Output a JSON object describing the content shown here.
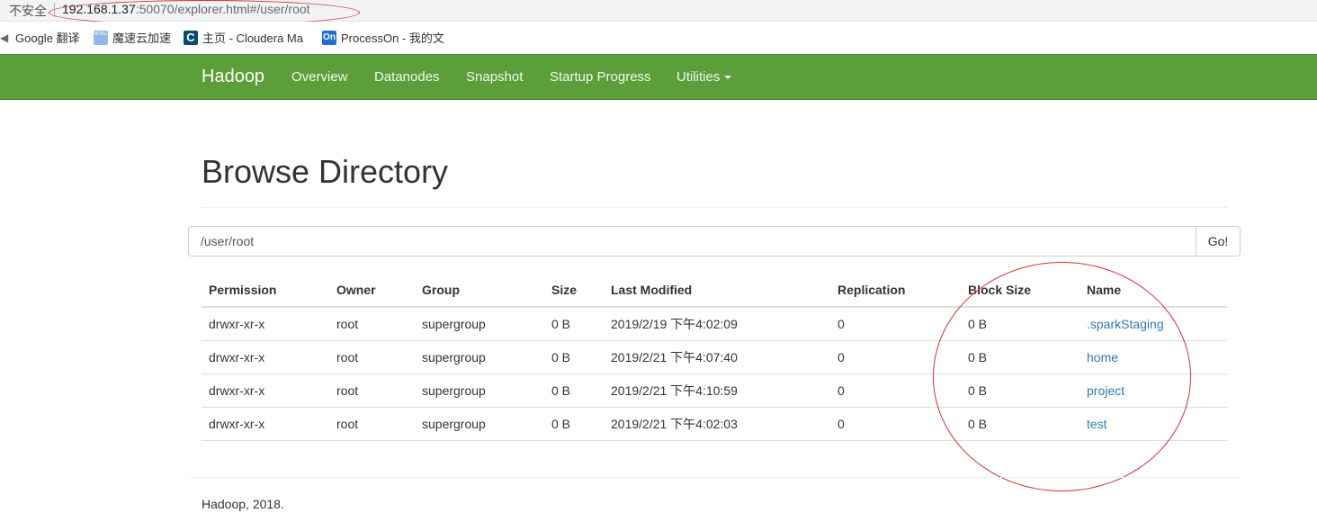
{
  "address_bar": {
    "security_label": "不安全",
    "url_host": "192.168.1.37",
    "url_rest": ":50070/explorer.html#/user/root"
  },
  "bookmarks": [
    {
      "label": "Google 翻译",
      "icon": "google-translate-icon"
    },
    {
      "label": "魔速云加速",
      "icon": "mosu-icon",
      "icon_text": "MOSU 魔速"
    },
    {
      "label": "主页 - Cloudera Ma",
      "icon": "cloudera-icon",
      "icon_text": "C"
    },
    {
      "label": "ProcessOn - 我的文",
      "icon": "processon-icon",
      "icon_text": "On"
    }
  ],
  "navbar": {
    "brand": "Hadoop",
    "links": [
      "Overview",
      "Datanodes",
      "Snapshot",
      "Startup Progress",
      "Utilities"
    ],
    "color": "#5c9e3a"
  },
  "page": {
    "title": "Browse Directory",
    "path_value": "/user/root",
    "go_label": "Go!"
  },
  "table": {
    "headers": [
      "Permission",
      "Owner",
      "Group",
      "Size",
      "Last Modified",
      "Replication",
      "Block Size",
      "Name"
    ],
    "rows": [
      [
        "drwxr-xr-x",
        "root",
        "supergroup",
        "0 B",
        "2019/2/19 下午4:02:09",
        "0",
        "0 B",
        ".sparkStaging"
      ],
      [
        "drwxr-xr-x",
        "root",
        "supergroup",
        "0 B",
        "2019/2/21 下午4:07:40",
        "0",
        "0 B",
        "home"
      ],
      [
        "drwxr-xr-x",
        "root",
        "supergroup",
        "0 B",
        "2019/2/21 下午4:10:59",
        "0",
        "0 B",
        "project"
      ],
      [
        "drwxr-xr-x",
        "root",
        "supergroup",
        "0 B",
        "2019/2/21 下午4:02:03",
        "0",
        "0 B",
        "test"
      ]
    ]
  },
  "footer": "Hadoop, 2018.",
  "annotation_color": "#d23030"
}
